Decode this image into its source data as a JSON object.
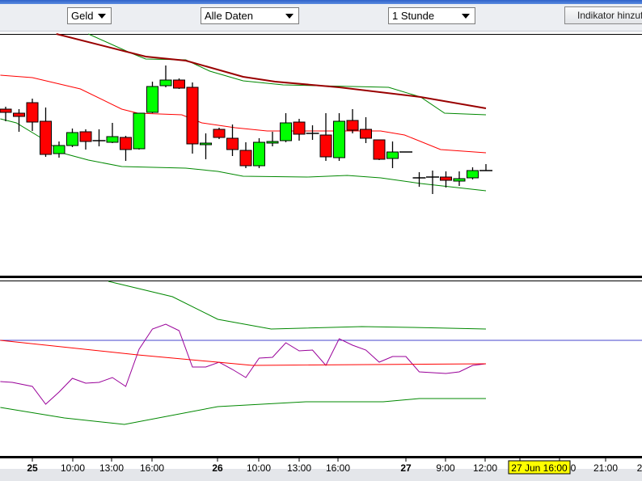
{
  "toolbar": {
    "price_select": "Geld",
    "range_select": "Alle Daten",
    "interval_select": "1 Stunde",
    "add_indicator_button": "Indikator hinzufügen"
  },
  "colors": {
    "bull_candle": "#00ff00",
    "bear_candle": "#ff0000",
    "moving_average": "#ff0000",
    "long_moving_average": "#990000",
    "bands": "#008800",
    "oscillator": "#990099",
    "reference_line": "#4444cc",
    "cursor_label_bg": "#ffff00"
  },
  "chart_data": [
    {
      "type": "candlestick",
      "panel": "price",
      "value_units": "relative (no price axis shown)",
      "candles": [
        {
          "o": 207,
          "h": 210,
          "l": 192,
          "c": 203
        },
        {
          "o": 202,
          "h": 207,
          "l": 179,
          "c": 198
        },
        {
          "o": 215,
          "h": 220,
          "l": 180,
          "c": 191
        },
        {
          "o": 192,
          "h": 209,
          "l": 148,
          "c": 151
        },
        {
          "o": 152,
          "h": 167,
          "l": 147,
          "c": 162
        },
        {
          "o": 162,
          "h": 183,
          "l": 160,
          "c": 178
        },
        {
          "o": 179,
          "h": 182,
          "l": 157,
          "c": 167
        },
        {
          "o": 168,
          "h": 182,
          "l": 161,
          "c": 168
        },
        {
          "o": 166,
          "h": 190,
          "l": 165,
          "c": 173
        },
        {
          "o": 172,
          "h": 174,
          "l": 143,
          "c": 157
        },
        {
          "o": 158,
          "h": 202,
          "l": 157,
          "c": 202
        },
        {
          "o": 203,
          "h": 241,
          "l": 202,
          "c": 235
        },
        {
          "o": 236,
          "h": 261,
          "l": 234,
          "c": 243
        },
        {
          "o": 243,
          "h": 245,
          "l": 232,
          "c": 233
        },
        {
          "o": 234,
          "h": 240,
          "l": 152,
          "c": 164
        },
        {
          "o": 163,
          "h": 177,
          "l": 145,
          "c": 165
        },
        {
          "o": 182,
          "h": 184,
          "l": 170,
          "c": 172
        },
        {
          "o": 171,
          "h": 188,
          "l": 149,
          "c": 157
        },
        {
          "o": 156,
          "h": 166,
          "l": 134,
          "c": 137
        },
        {
          "o": 137,
          "h": 171,
          "l": 134,
          "c": 166
        },
        {
          "o": 165,
          "h": 179,
          "l": 161,
          "c": 167
        },
        {
          "o": 168,
          "h": 202,
          "l": 166,
          "c": 190
        },
        {
          "o": 191,
          "h": 195,
          "l": 168,
          "c": 176
        },
        {
          "o": 177,
          "h": 187,
          "l": 169,
          "c": 177
        },
        {
          "o": 175,
          "h": 202,
          "l": 143,
          "c": 148
        },
        {
          "o": 147,
          "h": 202,
          "l": 143,
          "c": 192
        },
        {
          "o": 193,
          "h": 207,
          "l": 177,
          "c": 181
        },
        {
          "o": 182,
          "h": 197,
          "l": 165,
          "c": 171
        },
        {
          "o": 169,
          "h": 169,
          "l": 144,
          "c": 145
        },
        {
          "o": 146,
          "h": 167,
          "l": 134,
          "c": 154
        },
        {
          "o": 154,
          "h": 154,
          "l": 154,
          "c": 154
        },
        {
          "o": 122,
          "h": 129,
          "l": 111,
          "c": 122
        },
        {
          "o": 123,
          "h": 131,
          "l": 102,
          "c": 123
        },
        {
          "o": 123,
          "h": 130,
          "l": 110,
          "c": 119
        },
        {
          "o": 118,
          "h": 130,
          "l": 112,
          "c": 121
        },
        {
          "o": 122,
          "h": 135,
          "l": 120,
          "c": 131
        },
        {
          "o": 131,
          "h": 139,
          "l": 131,
          "c": 131
        }
      ],
      "lines": [
        {
          "role": "moving-average",
          "color": "#ff0000",
          "points": [
            [
              -0.4,
              249
            ],
            [
              2,
              246
            ],
            [
              5.6,
              232
            ],
            [
              8.7,
              207
            ],
            [
              9.9,
              202
            ],
            [
              13.2,
              200
            ],
            [
              14.7,
              190
            ],
            [
              17.2,
              184
            ],
            [
              19.6,
              180
            ],
            [
              23.8,
              180
            ],
            [
              28.1,
              180
            ],
            [
              29.9,
              175
            ],
            [
              32.6,
              157
            ],
            [
              36,
              153
            ]
          ]
        },
        {
          "role": "upper-band",
          "color": "#008800",
          "points": [
            [
              6.2,
              300
            ],
            [
              9.3,
              277
            ],
            [
              10.5,
              269
            ],
            [
              13.5,
              268
            ],
            [
              15.3,
              254
            ],
            [
              17.8,
              242
            ],
            [
              20.8,
              237
            ],
            [
              28.7,
              234
            ],
            [
              31.1,
              222
            ],
            [
              32.9,
              202
            ],
            [
              36,
              200
            ]
          ]
        },
        {
          "role": "long-moving-average",
          "color": "#990000",
          "points": [
            [
              3.8,
              300
            ],
            [
              10.5,
              272
            ],
            [
              13.5,
              267
            ],
            [
              17.8,
              247
            ],
            [
              20.2,
              241
            ],
            [
              25,
              234
            ],
            [
              31.1,
              222
            ],
            [
              36,
              208
            ]
          ]
        },
        {
          "role": "lower-band",
          "color": "#008800",
          "points": [
            [
              -0.4,
              195
            ],
            [
              0.8,
              190
            ],
            [
              2.6,
              172
            ],
            [
              4.4,
              152
            ],
            [
              6.2,
              144
            ],
            [
              8.7,
              136
            ],
            [
              13.5,
              134
            ],
            [
              15.9,
              130
            ],
            [
              17.8,
              124
            ],
            [
              22.6,
              123
            ],
            [
              25.6,
              125
            ],
            [
              28.1,
              122
            ],
            [
              31.1,
              115
            ],
            [
              36,
              106
            ]
          ]
        }
      ]
    },
    {
      "type": "line",
      "panel": "indicator",
      "value_units": "relative (no axis shown)",
      "reference_level": 144,
      "series": [
        {
          "role": "oscillator",
          "color": "#990099",
          "points": [
            [
              -0.4,
              93
            ],
            [
              0.5,
              92
            ],
            [
              2,
              87
            ],
            [
              3,
              65
            ],
            [
              4,
              80
            ],
            [
              5,
              97
            ],
            [
              6,
              91
            ],
            [
              7,
              92
            ],
            [
              8,
              98
            ],
            [
              9,
              87
            ],
            [
              10,
              133
            ],
            [
              11,
              158
            ],
            [
              12,
              164
            ],
            [
              13,
              156
            ],
            [
              14,
              111
            ],
            [
              15,
              111
            ],
            [
              16,
              117
            ],
            [
              17,
              108
            ],
            [
              18,
              98
            ],
            [
              19,
              122
            ],
            [
              20,
              123
            ],
            [
              21,
              141
            ],
            [
              22,
              131
            ],
            [
              23,
              132
            ],
            [
              24,
              113
            ],
            [
              25,
              146
            ],
            [
              26,
              138
            ],
            [
              27,
              132
            ],
            [
              28,
              117
            ],
            [
              29,
              124
            ],
            [
              30,
              124
            ],
            [
              31,
              105
            ],
            [
              32,
              104
            ],
            [
              33,
              103
            ],
            [
              34,
              105
            ],
            [
              35,
              113
            ],
            [
              36,
              115
            ]
          ]
        },
        {
          "role": "signal",
          "color": "#ff0000",
          "points": [
            [
              -0.4,
              144
            ],
            [
              9.9,
              126
            ],
            [
              15.9,
              117
            ],
            [
              18.5,
              113
            ],
            [
              36,
              115
            ]
          ]
        },
        {
          "role": "upper-band",
          "color": "#008800",
          "points": [
            [
              7.7,
              217
            ],
            [
              12.5,
              198
            ],
            [
              15.9,
              170
            ],
            [
              19.9,
              158
            ],
            [
              26.7,
              161
            ],
            [
              30.5,
              160
            ],
            [
              36,
              158
            ]
          ]
        },
        {
          "role": "lower-band",
          "color": "#008800",
          "points": [
            [
              -0.4,
              61
            ],
            [
              4.4,
              48
            ],
            [
              8.9,
              40
            ],
            [
              15.9,
              62
            ],
            [
              22.5,
              68
            ],
            [
              28.3,
              68
            ],
            [
              31,
              72
            ],
            [
              36,
              72
            ]
          ]
        }
      ]
    }
  ],
  "x_axis": {
    "labels": [
      "25",
      "10:00",
      "13:00",
      "16:00",
      "26",
      "10:00",
      "13:00",
      "16:00",
      "27",
      "9:00",
      "12:00",
      "0",
      "21:00",
      "2"
    ],
    "bold_labels": [
      "25",
      "26",
      "27"
    ],
    "cursor_label": "27 Jun 16:00"
  }
}
